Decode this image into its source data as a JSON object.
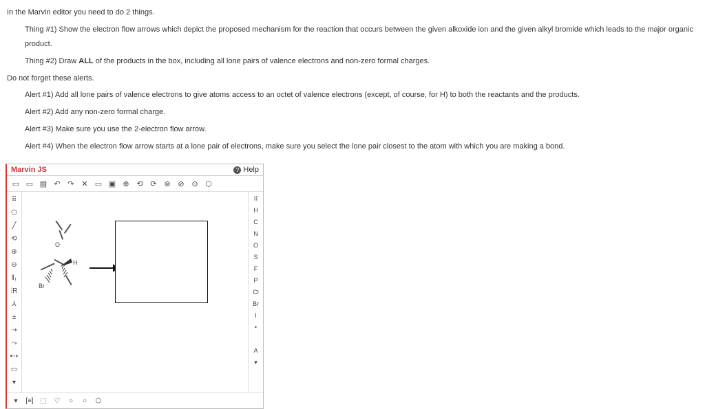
{
  "instructions": {
    "intro": "In the Marvin editor you need to do 2 things.",
    "thing1": "Thing #1) Show the electron flow arrows which depict the proposed mechanism for the reaction that occurs between the given alkoxide ion and the given alkyl bromide which leads to the major organic product.",
    "thing2_prefix": "Thing #2) Draw ",
    "thing2_bold": "ALL",
    "thing2_suffix": " of the products in the box, including all lone pairs of valence electrons and non-zero formal charges.",
    "alerts_intro": "Do not forget these alerts.",
    "alert1": "Alert #1) Add all lone pairs of valence electrons to give atoms access to an octet of valence electrons (except, of course, for H) to both the reactants and the products.",
    "alert2": "Alert #2) Add any non-zero formal charge.",
    "alert3": "Alert #3) Make sure you use the 2-electron flow arrow.",
    "alert4": "Alert #4) When the electron flow arrow starts at a lone pair of electrons, make sure you select the lone pair closest to the atom with which you are making a bond."
  },
  "editor": {
    "title": "Marvin JS",
    "help_label": "Help",
    "top_tools": [
      "▭",
      "▭",
      "▤",
      "↶",
      "↷",
      "✕",
      "▭",
      "▣",
      "⊕",
      "⟲",
      "⟳",
      "⊚",
      "⊘",
      "⊙",
      "⬡"
    ],
    "left_tools": [
      "⠿",
      "⬠",
      "╱",
      "⟲",
      "⊕",
      "⊖",
      "‖₁",
      "⫶R",
      "⅄",
      "±",
      "⇢",
      "⤳",
      "•⇢",
      "▭"
    ],
    "right_tools": [
      "⠿",
      "H",
      "C",
      "N",
      "O",
      "S",
      "F",
      "P",
      "Cl",
      "Br",
      "I",
      "•",
      "",
      "A"
    ],
    "bottom_tools": [
      "▾",
      "[≡]",
      "⬚",
      "♡",
      "○",
      "○",
      "⬡"
    ],
    "atoms": {
      "h_label": "H",
      "o_label": "O",
      "br_label": "Br"
    }
  }
}
